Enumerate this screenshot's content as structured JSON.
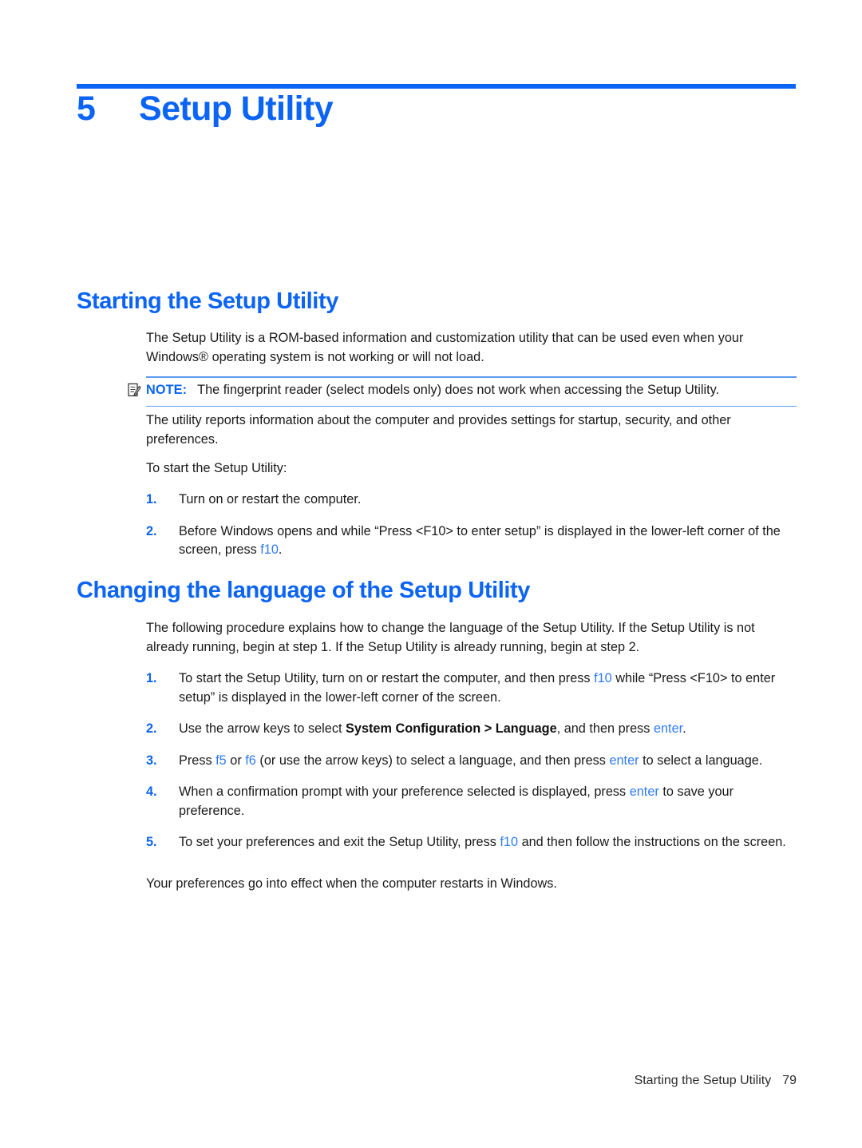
{
  "chapter": {
    "number": "5",
    "title": "Setup Utility"
  },
  "sections": [
    {
      "heading": "Starting the Setup Utility",
      "intro_line1": "The Setup Utility is a ROM-based information and customization utility that can be used even when your",
      "intro_line2": "Windows® operating system is not working or will not load.",
      "note": {
        "icon": "note-pencil-icon",
        "label": "NOTE:",
        "text": "The fingerprint reader (select models only) does not work when accessing the Setup Utility."
      },
      "para_after_note_line1": "The utility reports information about the computer and provides settings for startup, security, and other",
      "para_after_note_line2": "preferences.",
      "lead_in": "To start the Setup Utility:",
      "steps": [
        {
          "number": "1.",
          "pre": "Turn on or restart the computer.",
          "key": "",
          "post": ""
        },
        {
          "number": "2.",
          "pre": "Before Windows opens and while “Press <F10> to enter setup” is displayed in the lower-left corner of the screen, press ",
          "key": "f10",
          "post": "."
        }
      ]
    },
    {
      "heading": "Changing the language of the Setup Utility",
      "intro_line1": "The following procedure explains how to change the language of the Setup Utility. If the Setup Utility is",
      "intro_line2": "not already running, begin at step 1. If the Setup Utility is already running, begin at step 2.",
      "steps": [
        {
          "number": "1.",
          "seg1": "To start the Setup Utility, turn on or restart the computer, and then press ",
          "key1": "f10",
          "seg2": " while “Press <F10> to enter setup” is displayed in the lower-left corner of the screen.",
          "key2": "",
          "seg3": ""
        },
        {
          "number": "2.",
          "seg1": "Use the arrow keys to select ",
          "bold": "System Configuration > Language",
          "seg2": ", and then press ",
          "key2": "enter",
          "seg3": "."
        },
        {
          "number": "3.",
          "seg1": "Press ",
          "key1": "f5",
          "seg2": " or ",
          "key1b": "f6",
          "seg3": " (or use the arrow keys) to select a language, and then press ",
          "key2": "enter",
          "seg4": " to select a language."
        },
        {
          "number": "4.",
          "seg1": "When a confirmation prompt with your preference selected is displayed, press ",
          "key2": "enter",
          "seg3": " to save your preference."
        },
        {
          "number": "5.",
          "seg1": "To set your preferences and exit the Setup Utility, press ",
          "key1": "f10",
          "seg3": " and then follow the instructions on the screen."
        }
      ],
      "closing": "Your preferences go into effect when the computer restarts in Windows."
    }
  ],
  "footer": {
    "text": "Starting the Setup Utility",
    "page": "79"
  },
  "colors": {
    "accent_blue": "#0b64f4",
    "key_blue": "#2f7bf6",
    "rule_blue": "#5d9bf2",
    "body_text": "#1a1a1a"
  }
}
